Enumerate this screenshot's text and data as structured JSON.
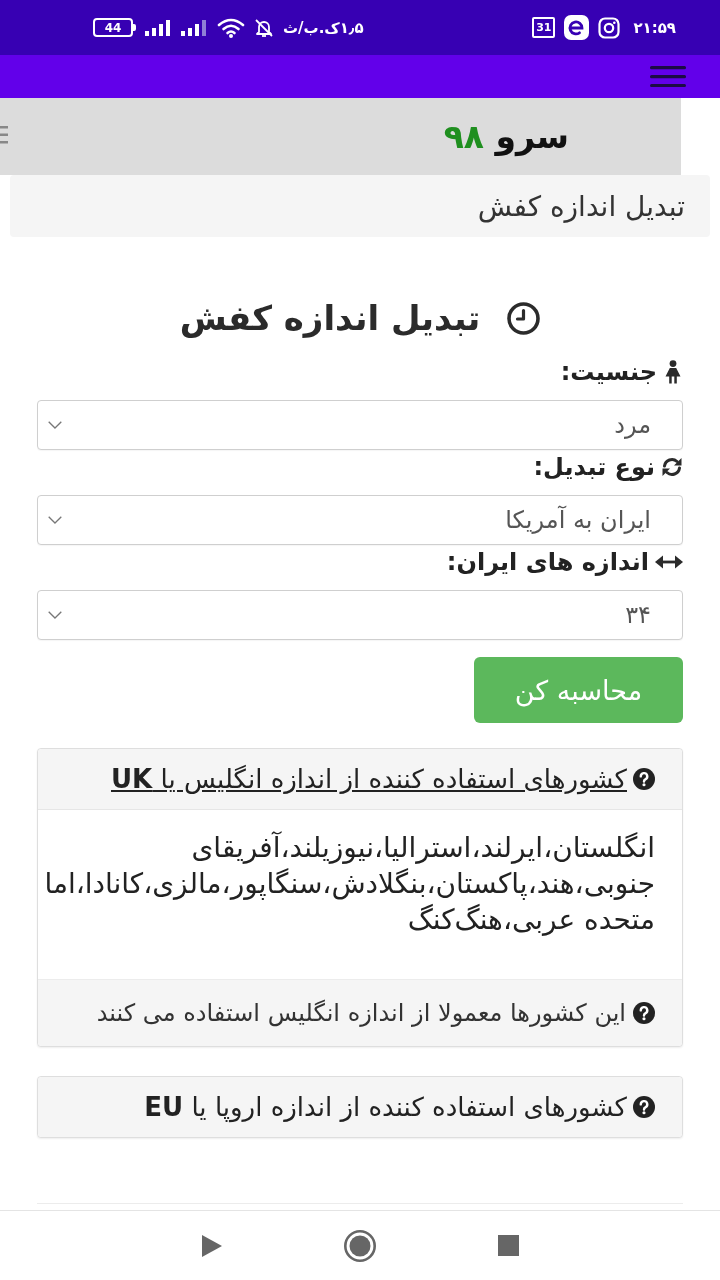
{
  "status_bar": {
    "battery": "44",
    "network_speed": "۱٫۵ک.ب/ث",
    "calendar_day": "31",
    "time": "۲۱:۵۹"
  },
  "site_header": {
    "logo_name": "سرو",
    "logo_number": "۹۸"
  },
  "breadcrumb": "تبدیل اندازه کفش",
  "heading": "تبدیل اندازه کفش",
  "form": {
    "fields": [
      {
        "label": "جنسیت:",
        "value": "مرد"
      },
      {
        "label": "نوع تبدیل:",
        "value": "ایران به آمریکا"
      },
      {
        "label": "اندازه های ایران:",
        "value": "۳۴"
      }
    ],
    "submit": "محاسبه کن"
  },
  "panels": [
    {
      "title": "کشورهای استفاده کننده از اندازه انگلیس یا **UK**",
      "expanded": true,
      "body": "انگلستان،ایرلند،استرالیا،نیوزیلند،آفریقای\nجنوبی،هند،پاکستان،بنگلادش،سنگاپور،مالزی،کانادا،اما\nمتحده عربی،هنگ‌کنگ",
      "footer": "این کشورها معمولا از اندازه انگلیس استفاده می کنند"
    },
    {
      "title": "کشورهای استفاده کننده از اندازه اروپا یا **EU**",
      "expanded": false
    }
  ]
}
